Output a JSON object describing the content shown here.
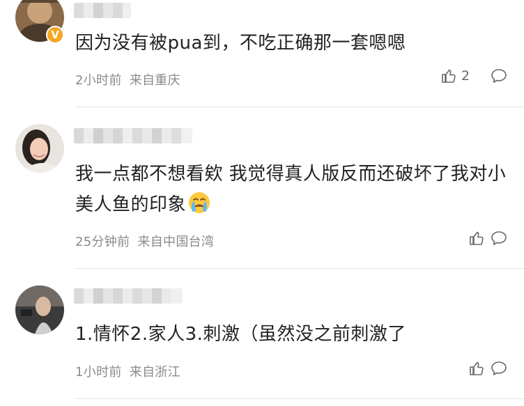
{
  "comments": [
    {
      "text": "因为没有被pua到，不吃正确那一套嗯嗯",
      "time": "2小时前",
      "location": "来自重庆",
      "likes": "2",
      "verified_badge": "V"
    },
    {
      "text": "我一点都不想看欸 我觉得真人版反而还破坏了我对小美人鱼的印象",
      "emoji": "crying-face",
      "time": "25分钟前",
      "location": "来自中国台湾",
      "likes": ""
    },
    {
      "text": "1.情怀2.家人3.刺激（虽然没之前刺激了",
      "time": "1小时前",
      "location": "来自浙江",
      "likes": ""
    }
  ],
  "colors": {
    "text": "#222222",
    "meta": "#8a8a8a",
    "icon": "#666666",
    "badge": "#f5a623",
    "divider": "#e3e3e3"
  },
  "icons": {
    "like": "thumbs-up-icon",
    "reply": "speech-bubble-icon"
  }
}
